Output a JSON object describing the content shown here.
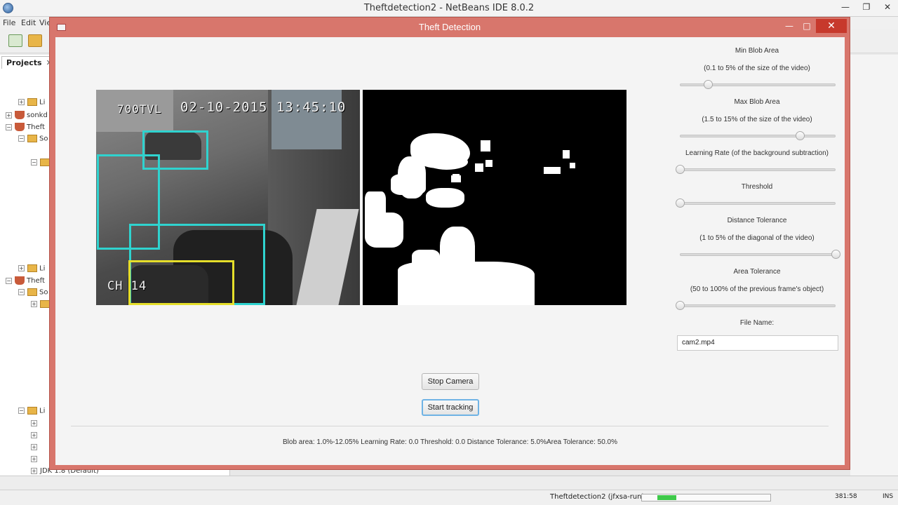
{
  "ide": {
    "title": "Theftdetection2 - NetBeans IDE 8.0.2",
    "menu": [
      "File",
      "Edit",
      "Vie"
    ],
    "projects_tab": "Projects",
    "tree": [
      "Li",
      "sonkd",
      "Theft",
      "So",
      "Li",
      "Theft",
      "So",
      "Li",
      "JDK 1.8 (Default)"
    ],
    "run_label": "Theftdetection2 (jfxsa-run)",
    "run_progress": 0.15,
    "caret": "381:58",
    "insert_mode": "INS"
  },
  "window": {
    "title": "Theft Detection",
    "minimize": "—",
    "maximize": "□",
    "close": "✕"
  },
  "camera": {
    "osd_id": "700TVL",
    "osd_timestamp": "02-10-2015 13:45:10",
    "osd_channel": "CH 14"
  },
  "buttons": {
    "stop_camera": "Stop Camera",
    "start_tracking": "Start tracking"
  },
  "controls": {
    "min_blob": {
      "label": "Min Blob Area",
      "hint": "(0.1 to 5% of the size of the video)",
      "value": 0.18
    },
    "max_blob": {
      "label": "Max Blob Area",
      "hint": "(1.5 to 15% of the size of the video)",
      "value": 0.77
    },
    "learning_rate": {
      "label": "Learning Rate (of the background subtraction)",
      "value": 0.0
    },
    "threshold": {
      "label": "Threshold",
      "value": 0.0
    },
    "distance_tolerance": {
      "label": "Distance Tolerance",
      "hint": "(1 to 5% of the diagonal  of the video)",
      "value": 1.0
    },
    "area_tolerance": {
      "label": "Area Tolerance",
      "hint": "(50 to 100% of the previous frame's object)",
      "value": 0.0
    },
    "file_name": {
      "label": "File Name:",
      "value": "cam2.mp4"
    }
  },
  "status_text": "Blob area: 1.0%-12.05%  Learning Rate: 0.0   Threshold: 0.0  Distance Tolerance: 5.0%Area Tolerance: 50.0%"
}
